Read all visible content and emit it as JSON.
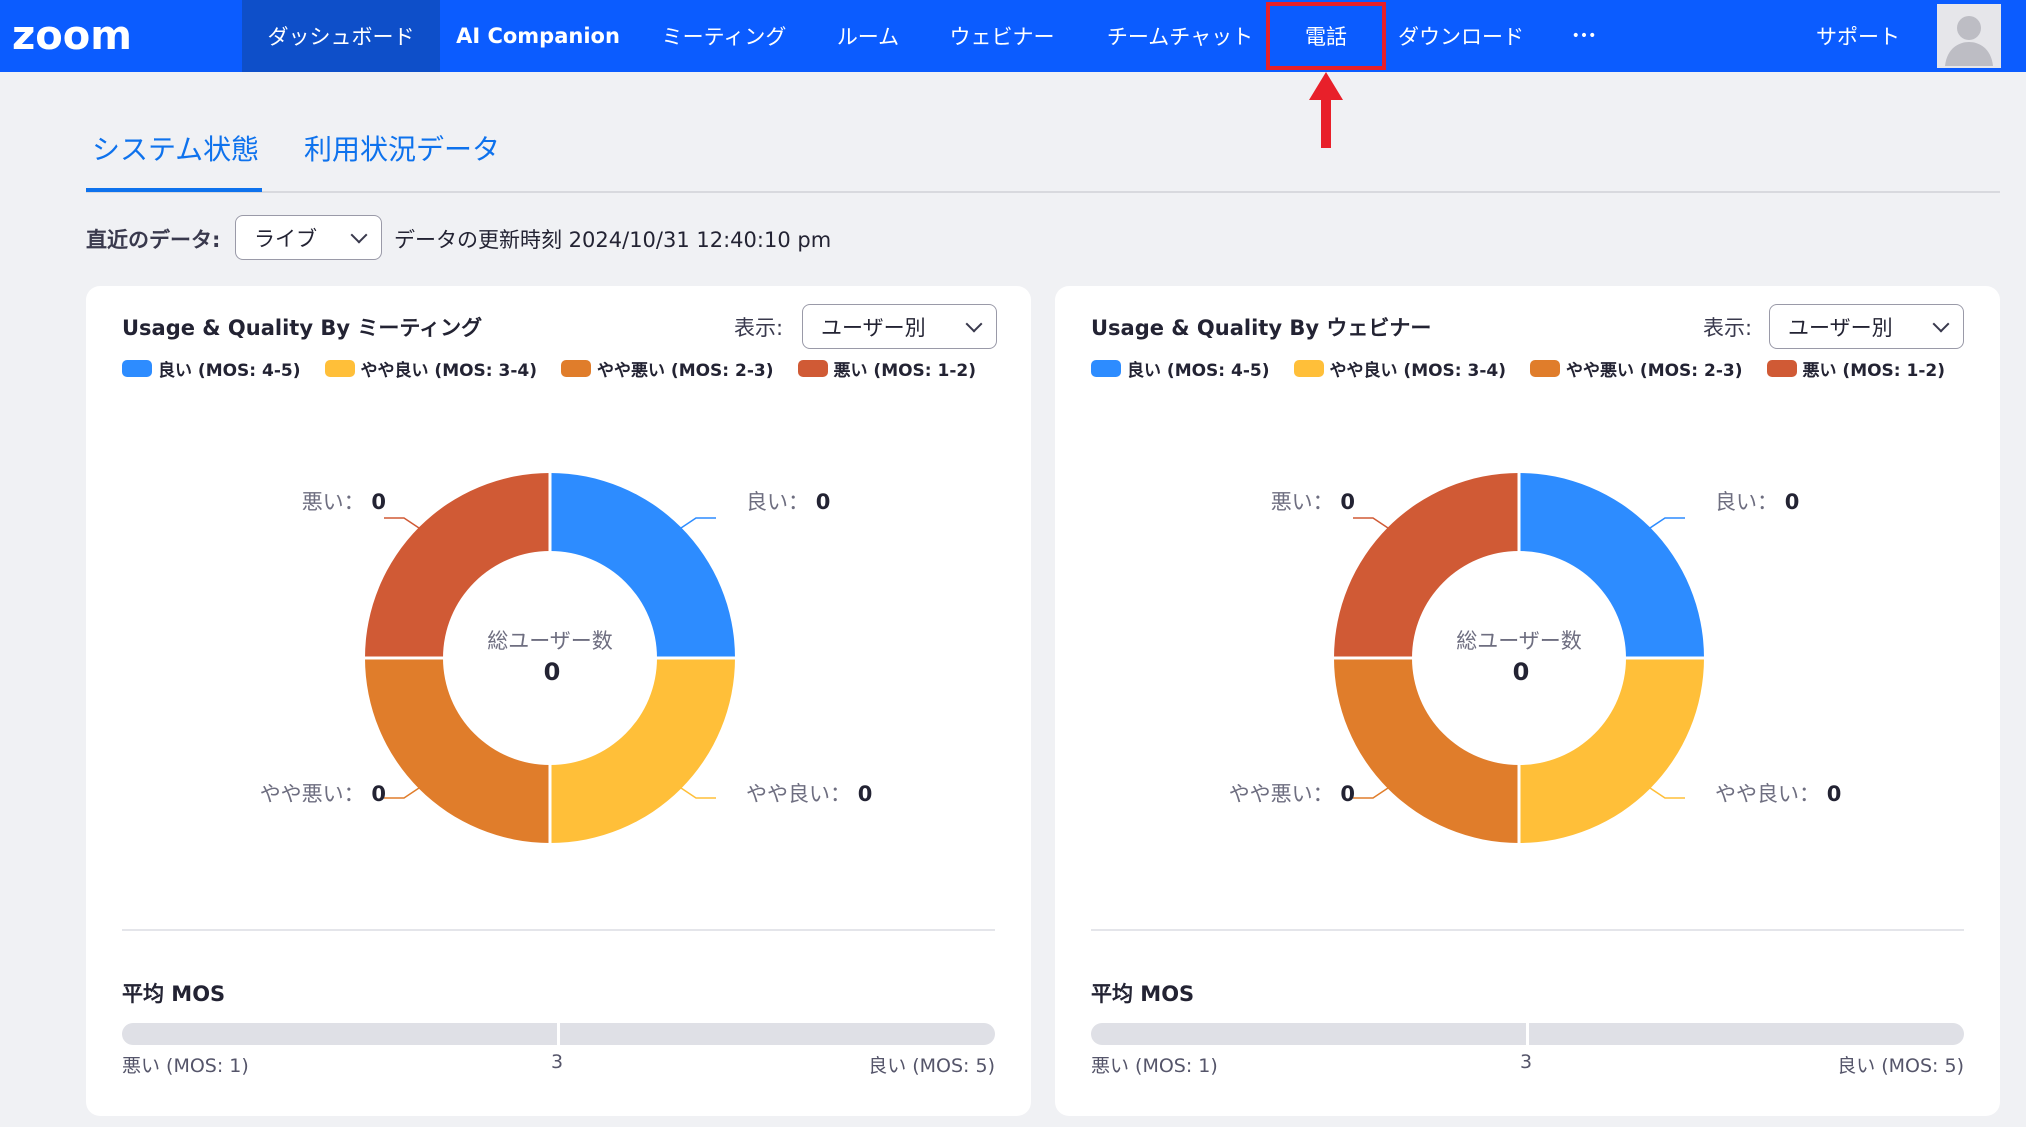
{
  "app": {
    "logo": "zoom"
  },
  "nav": {
    "items": [
      {
        "label": "ダッシュボード",
        "active": true
      },
      {
        "label": "AI Companion"
      },
      {
        "label": "ミーティング"
      },
      {
        "label": "ルーム"
      },
      {
        "label": "ウェビナー"
      },
      {
        "label": "チームチャット"
      },
      {
        "label": "電話"
      },
      {
        "label": "ダウンロード"
      },
      {
        "label": "•••"
      }
    ],
    "support": "サポート",
    "avatar_icon": "user-avatar-icon"
  },
  "tabs": [
    {
      "label": "システム状態",
      "active": true
    },
    {
      "label": "利用状況データ"
    }
  ],
  "filter": {
    "label": "直近のデータ:",
    "value": "ライブ",
    "updated": "データの更新時刻 2024/10/31 12:40:10 pm"
  },
  "colors": {
    "accent": "#0b5cff",
    "good": "#2d8cff",
    "fair": "#ffbf39",
    "poor": "#e07d2b",
    "bad": "#d05a35",
    "highlight": "#e8202a"
  },
  "cards": [
    {
      "title": "Usage & Quality By ミーティング",
      "display_label": "表示:",
      "display_value": "ユーザー別",
      "legend": [
        {
          "label": "良い (MOS: 4-5)"
        },
        {
          "label": "やや良い (MOS: 3-4)"
        },
        {
          "label": "やや悪い (MOS: 2-3)"
        },
        {
          "label": "悪い (MOS: 1-2)"
        }
      ],
      "center_label": "総ユーザー数",
      "center_value": "0",
      "slices": [
        {
          "name": "良い：",
          "value": "0"
        },
        {
          "name": "やや良い：",
          "value": "0"
        },
        {
          "name": "やや悪い：",
          "value": "0"
        },
        {
          "name": "悪い：",
          "value": "0"
        }
      ],
      "mos_title": "平均 MOS",
      "mos_min": "悪い (MOS: 1)",
      "mos_mid": "3",
      "mos_max": "良い (MOS: 5)"
    },
    {
      "title": "Usage & Quality By ウェビナー",
      "display_label": "表示:",
      "display_value": "ユーザー別",
      "legend": [
        {
          "label": "良い (MOS: 4-5)"
        },
        {
          "label": "やや良い (MOS: 3-4)"
        },
        {
          "label": "やや悪い (MOS: 2-3)"
        },
        {
          "label": "悪い (MOS: 1-2)"
        }
      ],
      "center_label": "総ユーザー数",
      "center_value": "0",
      "slices": [
        {
          "name": "良い：",
          "value": "0"
        },
        {
          "name": "やや良い：",
          "value": "0"
        },
        {
          "name": "やや悪い：",
          "value": "0"
        },
        {
          "name": "悪い：",
          "value": "0"
        }
      ],
      "mos_title": "平均 MOS",
      "mos_min": "悪い (MOS: 1)",
      "mos_mid": "3",
      "mos_max": "良い (MOS: 5)"
    }
  ]
}
